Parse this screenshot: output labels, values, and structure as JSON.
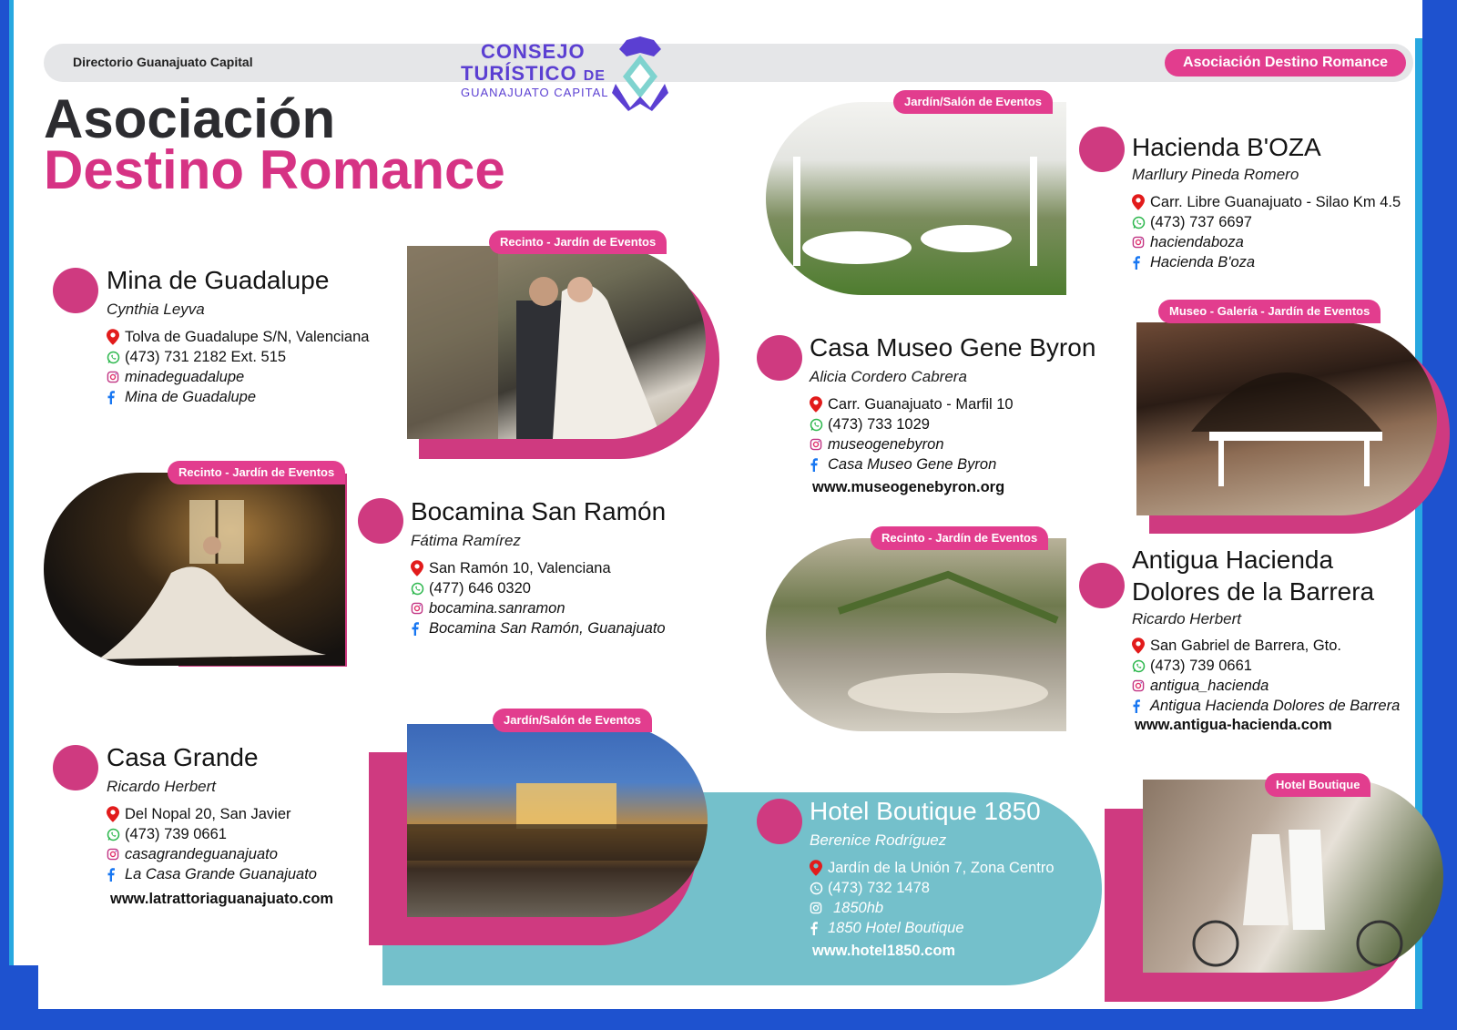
{
  "header": {
    "left_label": "Directorio Guanajuato Capital",
    "badge": "Asociación Destino Romance"
  },
  "logo": {
    "line1": "CONSEJO",
    "line2": "TURÍSTICO",
    "line2_suffix": "DE",
    "line3": "GUANAJUATO CAPITAL"
  },
  "title": {
    "line1": "Asociación",
    "line2": "Destino Romance"
  },
  "colors": {
    "pink": "#cf3a80",
    "blue_frame": "#1e52cf",
    "teal": "#74c0cb",
    "logo_purple": "#5b3fd2"
  },
  "tags": {
    "mina": "Recinto - Jardín de Eventos",
    "bocamina": "Recinto - Jardín de Eventos",
    "casa_grande": "Jardín/Salón de Eventos",
    "boza": "Jardín/Salón de Eventos",
    "gene_byron": "Museo - Galería - Jardín de Eventos",
    "antigua": "Recinto - Jardín de Eventos",
    "hotel": "Hotel Boutique"
  },
  "entries": {
    "mina": {
      "name": "Mina de Guadalupe",
      "contact": "Cynthia Leyva",
      "address": "Tolva de Guadalupe S/N, Valenciana",
      "phone": "(473) 731 2182 Ext. 515",
      "instagram": "minadeguadalupe",
      "facebook": "Mina de Guadalupe"
    },
    "bocamina": {
      "name": "Bocamina San Ramón",
      "contact": "Fátima Ramírez",
      "address": "San Ramón  10, Valenciana",
      "phone": "(477) 646 0320",
      "instagram": "bocamina.sanramon",
      "facebook": "Bocamina San Ramón, Guanajuato"
    },
    "casa_grande": {
      "name": "Casa Grande",
      "contact": "Ricardo Herbert",
      "address": "Del Nopal 20, San Javier",
      "phone": "(473) 739 0661",
      "instagram": "casagrandeguanajuato",
      "facebook": "La Casa Grande Guanajuato",
      "web": "www.latrattoriaguanajuato.com"
    },
    "boza": {
      "name": "Hacienda B'OZA",
      "contact": "Marllury Pineda Romero",
      "address": "Carr. Libre Guanajuato - Silao Km 4.5",
      "phone": "(473) 737 6697",
      "instagram": "haciendaboza",
      "facebook": "Hacienda B'oza"
    },
    "gene_byron": {
      "name": "Casa Museo Gene Byron",
      "contact": "Alicia Cordero Cabrera",
      "address": "Carr. Guanajuato - Marfil 10",
      "phone": "(473) 733 1029",
      "instagram": "museogenebyron",
      "facebook": "Casa Museo Gene Byron",
      "web": "www.museogenebyron.org"
    },
    "antigua": {
      "name_line1": "Antigua Hacienda",
      "name_line2": "Dolores de la Barrera",
      "contact": "Ricardo Herbert",
      "address": "San Gabriel de Barrera, Gto.",
      "phone": "(473) 739 0661",
      "instagram": "antigua_hacienda",
      "facebook": "Antigua Hacienda Dolores de Barrera",
      "web": "www.antigua-hacienda.com"
    },
    "hotel": {
      "name": "Hotel Boutique 1850",
      "contact": "Berenice Rodríguez",
      "address": "Jardín de la Unión 7,  Zona Centro",
      "phone": "(473) 732 1478",
      "instagram": "1850hb",
      "facebook": "1850 Hotel Boutique",
      "web": "www.hotel1850.com"
    }
  }
}
